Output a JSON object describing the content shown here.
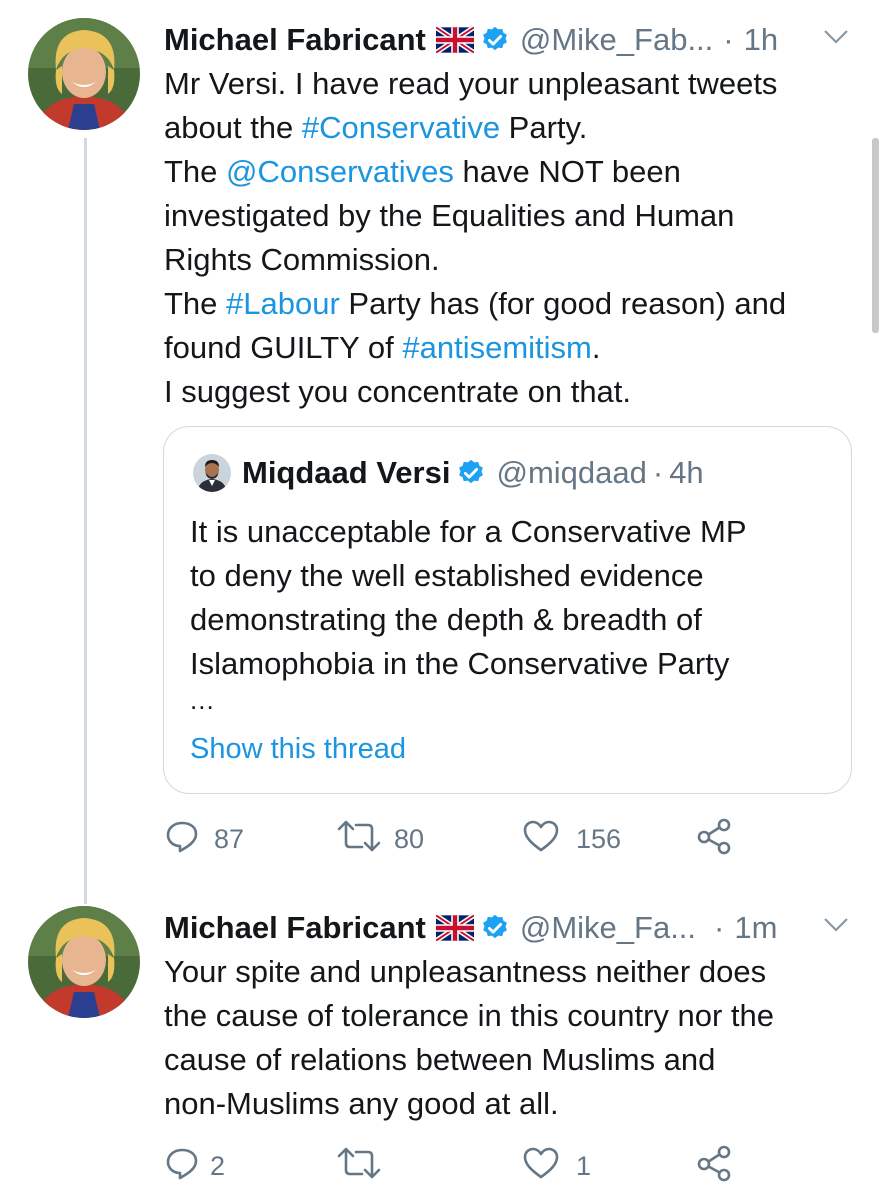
{
  "tweet1": {
    "author_name": "Michael Fabricant",
    "handle": "@Mike_Fab...",
    "separator": "·",
    "time": "1h",
    "lines": [
      [
        {
          "t": "Mr Versi.  I have read your unpleasant tweets"
        }
      ],
      [
        {
          "t": "about the "
        },
        {
          "t": "#Conservative",
          "link": true
        },
        {
          "t": " Party."
        }
      ],
      [
        {
          "t": "The "
        },
        {
          "t": "@Conservatives",
          "link": true
        },
        {
          "t": " have NOT been"
        }
      ],
      [
        {
          "t": "investigated by the Equalities and Human"
        }
      ],
      [
        {
          "t": "Rights Commission."
        }
      ],
      [
        {
          "t": "The "
        },
        {
          "t": "#Labour",
          "link": true
        },
        {
          "t": " Party has (for good reason) and"
        }
      ],
      [
        {
          "t": "found GUILTY of "
        },
        {
          "t": "#antisemitism",
          "link": true
        },
        {
          "t": "."
        }
      ],
      [
        {
          "t": "I suggest you concentrate on that."
        }
      ]
    ],
    "quoted": {
      "author_name": "Miqdaad Versi",
      "handle": "@miqdaad",
      "separator": "·",
      "time": "4h",
      "lines": [
        "It is unacceptable for a Conservative MP",
        "to deny the well established evidence",
        "demonstrating the depth & breadth of",
        "Islamophobia in the Conservative Party"
      ],
      "ellipsis": "...",
      "show_thread": "Show this thread"
    },
    "stats": {
      "replies": "87",
      "retweets": "80",
      "likes": "156"
    }
  },
  "tweet2": {
    "author_name": "Michael Fabricant",
    "handle": "@Mike_Fa...",
    "separator": "·",
    "time": "1m",
    "lines": [
      [
        {
          "t": "Your spite and unpleasantness neither does"
        }
      ],
      [
        {
          "t": "the cause of tolerance in this country nor the"
        }
      ],
      [
        {
          "t": "cause of relations between Muslims and"
        }
      ],
      [
        {
          "t": "non-Muslims any good at all."
        }
      ]
    ],
    "stats": {
      "replies": "2",
      "retweets": "",
      "likes": "1"
    }
  },
  "colors": {
    "link": "#1b95e0",
    "secondary_text": "#657786",
    "verified": "#1da1f2",
    "border": "#cfd9de"
  },
  "icons": [
    "uk-flag-icon",
    "verified-badge-icon",
    "chevron-down-icon",
    "reply-icon",
    "retweet-icon",
    "like-icon",
    "share-icon"
  ]
}
